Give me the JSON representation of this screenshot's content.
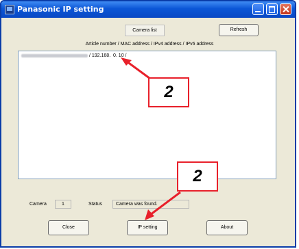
{
  "window": {
    "title": "Panasonic IP setting"
  },
  "toolbar": {
    "camera_list_label": "Camera list",
    "refresh_label": "Refresh"
  },
  "list": {
    "header": "Article number / MAC address / IPv4 address / IPv6 address",
    "rows": [
      {
        "ip_text": "/ 192.168.  0. 10 /"
      }
    ]
  },
  "status_bar": {
    "camera_label": "Camera",
    "camera_count": "1",
    "status_label": "Status",
    "status_text": "Camera was found."
  },
  "buttons": {
    "close_label": "Close",
    "ip_setting_label": "IP setting",
    "about_label": "About"
  },
  "callouts": {
    "top_number": "2",
    "bottom_number": "2"
  },
  "colors": {
    "title_bar": "#0b56d6",
    "dialog_bg": "#ece9d8",
    "callout_border": "#e8202a"
  },
  "icons": {
    "app": "panasonic-app-icon",
    "minimize": "minimize-icon",
    "maximize": "maximize-icon",
    "close": "close-icon"
  }
}
